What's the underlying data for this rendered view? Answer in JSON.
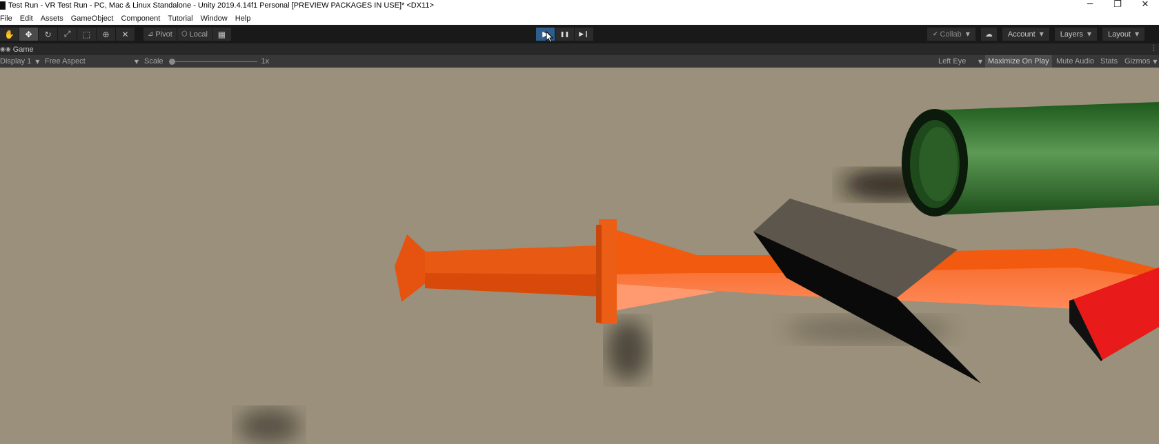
{
  "window": {
    "title": "Test Run - VR Test Run - PC, Mac & Linux Standalone - Unity 2019.4.14f1 Personal [PREVIEW PACKAGES IN USE]* <DX11>",
    "controls": {
      "minimize": "─",
      "restore": "❐",
      "close": "✕"
    }
  },
  "menu": [
    "File",
    "Edit",
    "Assets",
    "GameObject",
    "Component",
    "Tutorial",
    "Window",
    "Help"
  ],
  "toolbar": {
    "tools": [
      {
        "name": "hand-tool",
        "icon": "✋"
      },
      {
        "name": "move-tool",
        "icon": "✥"
      },
      {
        "name": "rotate-tool",
        "icon": "↻"
      },
      {
        "name": "scale-tool",
        "icon": "⤢"
      },
      {
        "name": "rect-tool",
        "icon": "⬚"
      },
      {
        "name": "transform-tool",
        "icon": "⊕"
      },
      {
        "name": "custom-tool",
        "icon": "✕"
      }
    ],
    "active_tool": "move-tool",
    "pivot_label": "Pivot",
    "local_label": "Local",
    "grid_icon": "▦",
    "play_icon": "▶",
    "pause_icon": "❚❚",
    "step_icon": "▶❙",
    "play_active": true,
    "collab_label": "Collab",
    "cloud_icon": "☁",
    "account_label": "Account",
    "layers_label": "Layers",
    "layout_label": "Layout"
  },
  "game_view": {
    "tab_label": "Game",
    "tab_icon": "◉◉",
    "display_label": "Display 1",
    "aspect_label": "Free Aspect",
    "scale_label": "Scale",
    "scale_value_label": "1x",
    "eye_label": "Left Eye",
    "maximize_label": "Maximize On Play",
    "maximize_on": true,
    "mute_label": "Mute Audio",
    "stats_label": "Stats",
    "gizmos_label": "Gizmos"
  },
  "scene_colors": {
    "floor": "#9a907b",
    "sword": "#f05a10",
    "sword_light": "#ff9a70",
    "pipe": "#2e6b2a",
    "block_top": "#5c564c",
    "red_block": "#e81a1a",
    "play_active": "#2f5d8c"
  }
}
